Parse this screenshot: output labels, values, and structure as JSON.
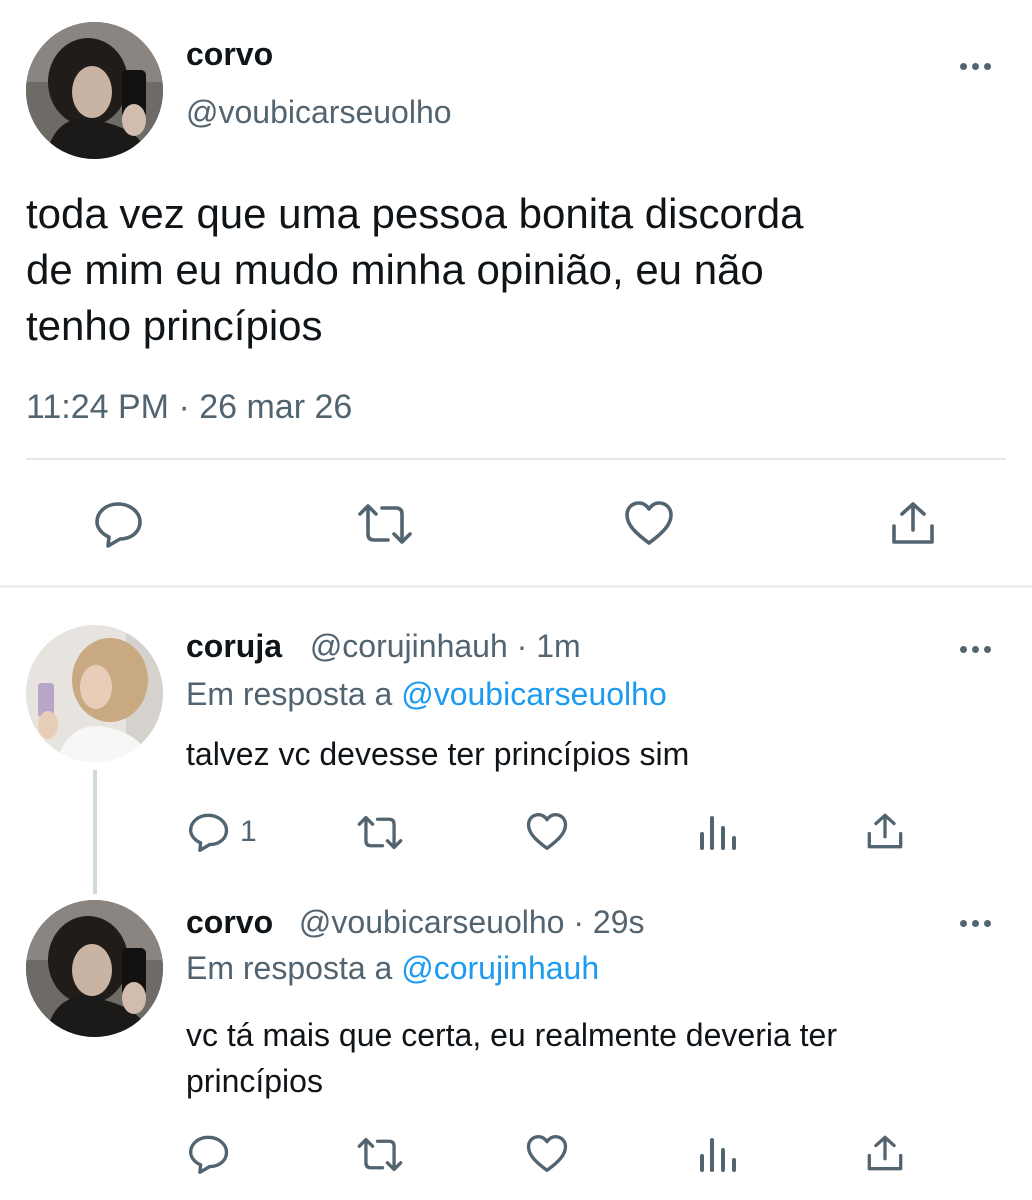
{
  "main_tweet": {
    "display_name": "corvo",
    "handle": "@voubicarseuolho",
    "text_lines": [
      "toda vez que uma pessoa bonita discorda",
      "de mim eu mudo minha opinião, eu não",
      "tenho princípios"
    ],
    "timestamp": "11:24 PM · 26 mar 26",
    "actions": [
      "reply-icon",
      "retweet-icon",
      "like-icon",
      "share-icon"
    ]
  },
  "replies": [
    {
      "display_name": "coruja",
      "handle": "@corujinhauh",
      "time": "· 1m",
      "replying_prefix": "Em resposta a",
      "replying_to": "@voubicarseuolho",
      "text": "talvez vc devesse ter princípios sim",
      "reply_count": "1"
    },
    {
      "display_name": "corvo",
      "handle": "@voubicarseuolho",
      "time": "· 29s",
      "replying_prefix": "Em resposta a",
      "replying_to": "@corujinhauh",
      "text_lines": [
        "vc tá mais que certa, eu realmente deveria ter",
        "princípios"
      ],
      "reply_count": ""
    }
  ],
  "colors": {
    "text": "#0f1419",
    "muted": "#536471",
    "link": "#1d9bf0",
    "divider": "#e6e6e6"
  }
}
